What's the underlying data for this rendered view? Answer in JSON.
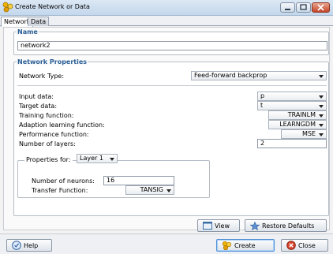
{
  "window": {
    "title": "Create Network or Data",
    "colors": {
      "title_bg": "#c3d7ec",
      "section_title": "#2a5f96",
      "close_button": "#c4462a"
    }
  },
  "tabs": [
    {
      "label": "Network",
      "active": true
    },
    {
      "label": "Data",
      "active": false
    }
  ],
  "name_section": {
    "title": "Name",
    "value": "network2"
  },
  "network_properties": {
    "title": "Network Properties",
    "network_type": {
      "label": "Network Type:",
      "value": "Feed-forward backprop"
    },
    "input_data": {
      "label": "Input data:",
      "value": "p"
    },
    "target_data": {
      "label": "Target data:",
      "value": "t"
    },
    "training_function": {
      "label": "Training function:",
      "value": "TRAINLM"
    },
    "adaption_function": {
      "label": "Adaption learning function:",
      "value": "LEARNGDM"
    },
    "performance_function": {
      "label": "Performance function:",
      "value": "MSE"
    },
    "number_of_layers": {
      "label": "Number of layers:",
      "value": "2"
    }
  },
  "layer_properties": {
    "properties_for_label": "Properties for:",
    "layer_value": "Layer 1",
    "neurons": {
      "label": "Number of neurons:",
      "value": "16"
    },
    "transfer": {
      "label": "Transfer Function:",
      "value": "TANSIG"
    }
  },
  "buttons": {
    "view": "View",
    "restore_defaults": "Restore Defaults",
    "help": "Help",
    "create": "Create",
    "close": "Close"
  },
  "icons": {
    "app": "network-icon",
    "view": "view-icon",
    "restore": "restore-star-icon",
    "help": "help-icon",
    "create": "create-icon",
    "close": "close-circle-icon"
  }
}
